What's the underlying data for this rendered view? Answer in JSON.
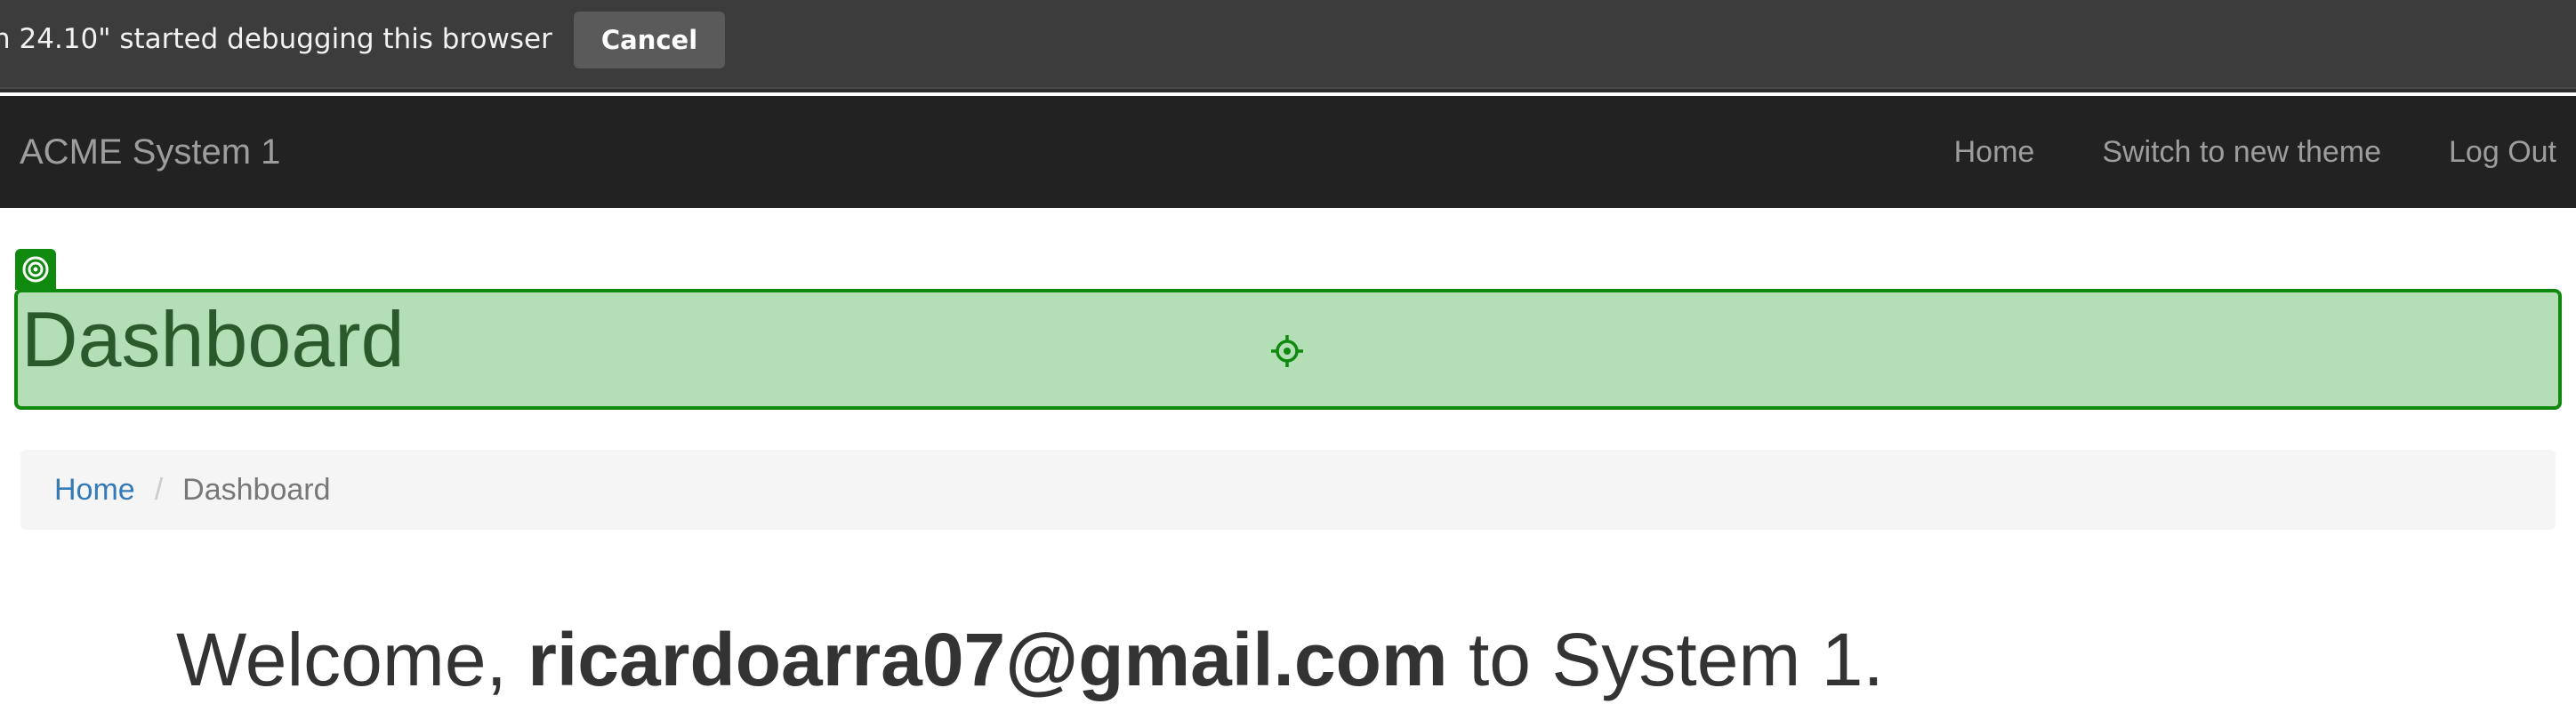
{
  "debug_bar": {
    "message": "n 24.10\" started debugging this browser",
    "cancel_label": "Cancel"
  },
  "navbar": {
    "brand": "ACME System 1",
    "links": [
      "Home",
      "Switch to new theme",
      "Log Out"
    ]
  },
  "page": {
    "title": "Dashboard"
  },
  "breadcrumb": {
    "home": "Home",
    "separator": "/",
    "current": "Dashboard"
  },
  "welcome": {
    "prefix": "Welcome, ",
    "user": "ricardoarra07@gmail.com",
    "suffix": " to System 1."
  },
  "highlight": {
    "color": "#0f8a0f",
    "fill": "#b4deb6",
    "tab_icon": "target-icon",
    "center_icon": "crosshair-icon"
  }
}
